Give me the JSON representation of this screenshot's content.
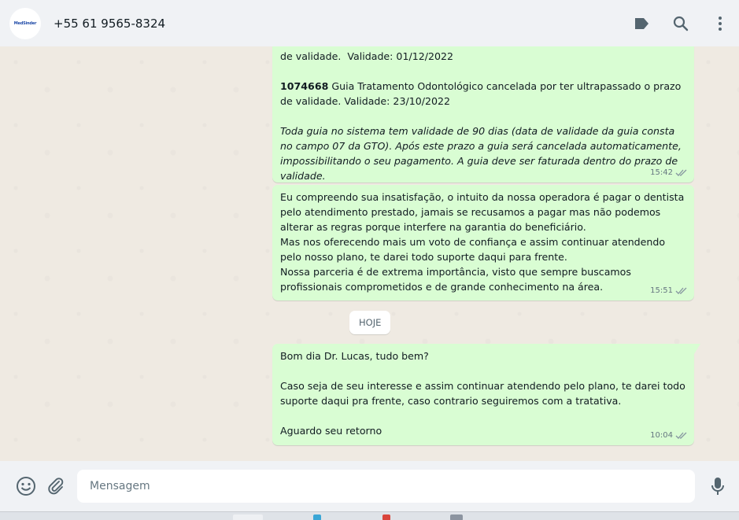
{
  "header": {
    "avatar_text": "MedSinder",
    "contact_name": "+55 61 9565-8324",
    "icons": [
      "label-icon",
      "search-icon",
      "menu-icon"
    ]
  },
  "messages": [
    {
      "line0": "de validade.  Validade: 01/12/2022",
      "guide_number": "1074668",
      "guide_text": " Guia Tratamento Odontológico cancelada por ter ultrapassado o prazo de validade. Validade: 23/10/2022",
      "note": "Toda guia no sistema tem validade de 90 dias (data de validade da guia consta no campo 07 da GTO). Após este prazo a guia será cancelada automaticamente, impossibilitando o seu pagamento. A guia deve ser faturada dentro do prazo de validade.",
      "time": "15:42"
    },
    {
      "p1": "Eu compreendo sua insatisfação, o intuito da nossa operadora é pagar o dentista pelo atendimento prestado, jamais se recusamos a pagar mas não podemos alterar as regras porque interfere na garantia do beneficiário.",
      "p2": "Mas nos oferecendo mais um voto de confiança e assim continuar atendendo pelo nosso plano, te darei todo suporte daqui para frente.",
      "p3": "Nossa parceria é de extrema importância, visto que sempre buscamos profissionais comprometidos e de grande conhecimento na área.",
      "time": "15:51"
    },
    {
      "p1": "Bom dia Dr. Lucas, tudo bem?",
      "p2": "Caso seja de seu interesse e assim continuar atendendo pelo plano, te darei todo suporte daqui pra frente, caso contrario seguiremos com a tratativa.",
      "p3": "Aguardo seu retorno",
      "time": "10:04"
    }
  ],
  "date_divider": "HOJE",
  "composer": {
    "placeholder": "Mensagem",
    "icons": [
      "emoji-icon",
      "attach-icon",
      "mic-icon"
    ]
  },
  "colors": {
    "outgoing_bubble": "#d9fdd3",
    "header_bg": "#f0f2f5",
    "chat_bg": "#efeae2"
  }
}
